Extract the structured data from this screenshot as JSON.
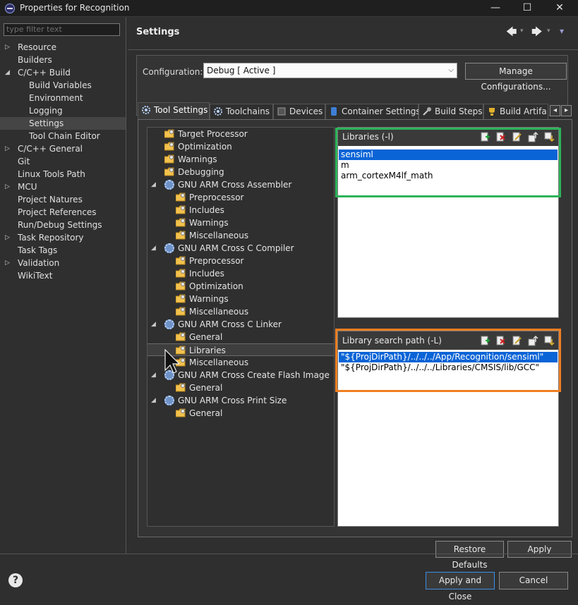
{
  "window": {
    "title": "Properties for Recognition",
    "minimize": "—",
    "maximize": "☐",
    "close": "✕"
  },
  "filter": {
    "placeholder": "type filter text"
  },
  "nav": {
    "items": [
      {
        "label": "Resource",
        "expand": "▷",
        "indent": 0
      },
      {
        "label": "Builders",
        "expand": "",
        "indent": 0
      },
      {
        "label": "C/C++ Build",
        "expand": "◢",
        "indent": 0
      },
      {
        "label": "Build Variables",
        "expand": "",
        "indent": 1
      },
      {
        "label": "Environment",
        "expand": "",
        "indent": 1
      },
      {
        "label": "Logging",
        "expand": "",
        "indent": 1
      },
      {
        "label": "Settings",
        "expand": "",
        "indent": 1,
        "selected": true
      },
      {
        "label": "Tool Chain Editor",
        "expand": "",
        "indent": 1
      },
      {
        "label": "C/C++ General",
        "expand": "▷",
        "indent": 0
      },
      {
        "label": "Git",
        "expand": "",
        "indent": 0
      },
      {
        "label": "Linux Tools Path",
        "expand": "",
        "indent": 0
      },
      {
        "label": "MCU",
        "expand": "▷",
        "indent": 0
      },
      {
        "label": "Project Natures",
        "expand": "",
        "indent": 0
      },
      {
        "label": "Project References",
        "expand": "",
        "indent": 0
      },
      {
        "label": "Run/Debug Settings",
        "expand": "",
        "indent": 0
      },
      {
        "label": "Task Repository",
        "expand": "▷",
        "indent": 0
      },
      {
        "label": "Task Tags",
        "expand": "",
        "indent": 0
      },
      {
        "label": "Validation",
        "expand": "▷",
        "indent": 0
      },
      {
        "label": "WikiText",
        "expand": "",
        "indent": 0
      }
    ]
  },
  "header": {
    "title": "Settings",
    "back": "🡄",
    "forward": "🡆",
    "menu": "▾"
  },
  "config": {
    "label": "Configuration:",
    "value": "Debug  [ Active ]",
    "manage": "Manage Configurations..."
  },
  "tabs": [
    "Tool Settings",
    "Toolchains",
    "Devices",
    "Container Settings",
    "Build Steps",
    "Build Artifa"
  ],
  "tabnav": {
    "left": "◂",
    "right": "▸"
  },
  "tree": [
    {
      "label": "Target Processor",
      "indent": 1,
      "kind": "folder"
    },
    {
      "label": "Optimization",
      "indent": 1,
      "kind": "folder"
    },
    {
      "label": "Warnings",
      "indent": 1,
      "kind": "folder"
    },
    {
      "label": "Debugging",
      "indent": 1,
      "kind": "folder"
    },
    {
      "label": "GNU ARM Cross Assembler",
      "indent": 1,
      "kind": "tool",
      "exp": "◢"
    },
    {
      "label": "Preprocessor",
      "indent": 2,
      "kind": "folder"
    },
    {
      "label": "Includes",
      "indent": 2,
      "kind": "folder"
    },
    {
      "label": "Warnings",
      "indent": 2,
      "kind": "folder"
    },
    {
      "label": "Miscellaneous",
      "indent": 2,
      "kind": "folder"
    },
    {
      "label": "GNU ARM Cross C Compiler",
      "indent": 1,
      "kind": "tool",
      "exp": "◢"
    },
    {
      "label": "Preprocessor",
      "indent": 2,
      "kind": "folder"
    },
    {
      "label": "Includes",
      "indent": 2,
      "kind": "folder"
    },
    {
      "label": "Optimization",
      "indent": 2,
      "kind": "folder"
    },
    {
      "label": "Warnings",
      "indent": 2,
      "kind": "folder"
    },
    {
      "label": "Miscellaneous",
      "indent": 2,
      "kind": "folder"
    },
    {
      "label": "GNU ARM Cross C Linker",
      "indent": 1,
      "kind": "tool",
      "exp": "◢"
    },
    {
      "label": "General",
      "indent": 2,
      "kind": "folder"
    },
    {
      "label": "Libraries",
      "indent": 2,
      "kind": "folder",
      "selected": true
    },
    {
      "label": "Miscellaneous",
      "indent": 2,
      "kind": "folder"
    },
    {
      "label": "GNU ARM Cross Create Flash Image",
      "indent": 1,
      "kind": "tool",
      "exp": "◢"
    },
    {
      "label": "General",
      "indent": 2,
      "kind": "folder"
    },
    {
      "label": "GNU ARM Cross Print Size",
      "indent": 1,
      "kind": "tool",
      "exp": "◢"
    },
    {
      "label": "General",
      "indent": 2,
      "kind": "folder"
    }
  ],
  "libraries": {
    "title": "Libraries (-l)",
    "items": [
      "sensiml",
      "m",
      "arm_cortexM4lf_math"
    ],
    "selected": 0
  },
  "searchpath": {
    "title": "Library search path (-L)",
    "items": [
      "\"${ProjDirPath}/../../../App/Recognition/sensiml\"",
      "\"${ProjDirPath}/../../../Libraries/CMSIS/lib/GCC\""
    ],
    "selected": 0
  },
  "buttons": {
    "restore": "Restore Defaults",
    "apply": "Apply",
    "apply_close": "Apply and Close",
    "cancel": "Cancel",
    "help": "?"
  },
  "colors": {
    "highlight_green": "#2db35a",
    "highlight_orange": "#f07f22",
    "selection": "#0a64d6"
  }
}
